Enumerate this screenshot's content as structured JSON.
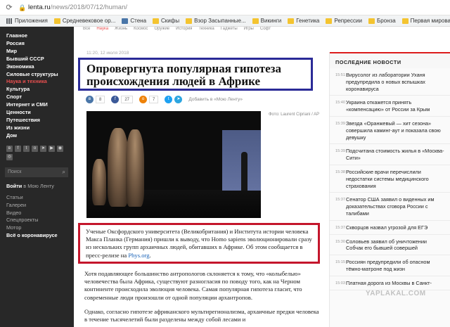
{
  "browser": {
    "url_host": "lenta.ru",
    "url_path": "/news/2018/07/12/human/"
  },
  "bookmarks": [
    {
      "label": "Приложения",
      "icon": "apps-icon"
    },
    {
      "label": "Средневековое ор...",
      "icon": "folder-icon"
    },
    {
      "label": "Стена",
      "icon": "vk-icon"
    },
    {
      "label": "Скифы",
      "icon": "folder-icon"
    },
    {
      "label": "Взор Засыпанные...",
      "icon": "folder-icon"
    },
    {
      "label": "Викинги",
      "icon": "folder-icon"
    },
    {
      "label": "Генетика",
      "icon": "folder-icon"
    },
    {
      "label": "Репрессии",
      "icon": "folder-icon"
    },
    {
      "label": "Бронза",
      "icon": "folder-icon"
    },
    {
      "label": "Первая мировая",
      "icon": "folder-icon"
    },
    {
      "label": "Ремонт",
      "icon": "folder-icon"
    }
  ],
  "sidebar": {
    "menu": [
      "Главное",
      "Россия",
      "Мир",
      "Бывший СССР",
      "Экономика",
      "Силовые структуры",
      "Наука и техника",
      "Культура",
      "Спорт",
      "Интернет и СМИ",
      "Ценности",
      "Путешествия",
      "Из жизни",
      "Дом"
    ],
    "active_index": 6,
    "search_placeholder": "Поиск",
    "login_bold": "Войти",
    "login_rest": " в Мою Ленту",
    "links": [
      "Статьи",
      "Галереи",
      "Видео",
      "Спецпроекты",
      "Мотор",
      "Всё о коронавирусе"
    ]
  },
  "article": {
    "date": "11:20, 12 июля 2018",
    "title": "Опровергнута популярная гипотеза происхождения людей в Африке",
    "share": {
      "vk_count": "8",
      "fb_count": "27",
      "ok_count": "7",
      "favorite": "Добавить в «Мою Ленту»"
    },
    "photo_credit": "Фото: Laurent Cipriani / AP",
    "lead_text": "Ученые Оксфордского университета (Великобритания) и Института истории человека Макса Планка (Германия) пришли к выводу, что Homo sapiens эволюционировали сразу из нескольких групп архаичных людей, обитавших в Африке. Об этом сообщается в пресс-релизе на ",
    "lead_link": "Phys.org",
    "lead_end": ".",
    "paragraph_1": "Хотя подавляющее большинство антропологов склоняется к тому, что «колыбелью» человечества была Африка, существуют разногласия по поводу того, как на Черном континенте происходила эволюция человека. Самая популярная гипотеза гласит, что современные люди произошли от одной популяции архантропов.",
    "paragraph_2": "Однако, согласно гипотезе африканского мультирегионализма, архаичные предки человека в течение тысячелетий были разделены между собой лесами и"
  },
  "news": {
    "header": "ПОСЛЕДНИЕ НОВОСТИ",
    "items": [
      {
        "time": "15:51",
        "text": "Вирусолог из лаборатории Уханя предупредила о новых вспышках коронавируса"
      },
      {
        "time": "15:40",
        "text": "Украина откажется принять «компенсацию» от России за Крым"
      },
      {
        "time": "15:39",
        "text": "Звезда «Оранжевый — хит сезона» совершила каминг-аут и показала свою девушку"
      },
      {
        "time": "15:39",
        "text": "Подсчитана стоимость жилья в «Москва-Сити»"
      },
      {
        "time": "15:38",
        "text": "Российские врачи перечислили недостатки системы медицинского страхования"
      },
      {
        "time": "15:37",
        "text": "Сенатор США заявил о виденных им доказательствах сговора России с талибами"
      },
      {
        "time": "15:37",
        "text": "Скворцов назвал угрозой для ЕГЭ"
      },
      {
        "time": "15:30",
        "text": "Соловьев заявил об уничтожении Собчак его бывшей совершей"
      },
      {
        "time": "15:15",
        "text": "Россиян предупредили об опасном тёмно-матроне под жизн"
      },
      {
        "time": "15:03",
        "text": "Платная дорога из Москвы в Санкт-"
      }
    ]
  },
  "topnav": [
    "Все",
    "Наука",
    "Жизнь",
    "Космос",
    "Оружие",
    "История",
    "Техника",
    "Гаджеты",
    "Игры",
    "Софт"
  ],
  "watermark": "YAPLAKAL.COM"
}
